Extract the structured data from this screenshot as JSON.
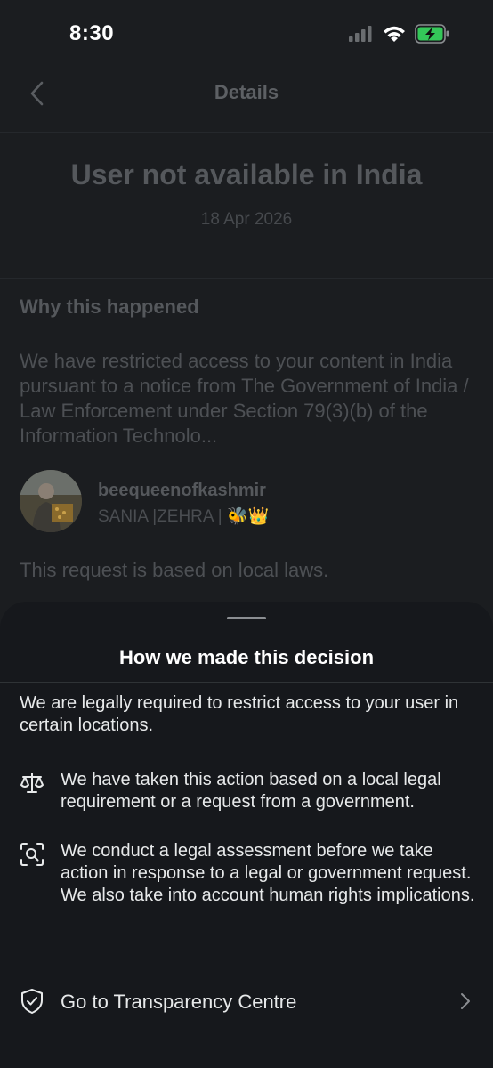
{
  "status": {
    "time": "8:30"
  },
  "nav": {
    "title": "Details"
  },
  "notice": {
    "heading": "User not available in India",
    "date": "18 Apr 2026"
  },
  "why": {
    "title": "Why this happened",
    "text": "We have restricted access to your content in India pursuant to a notice from The Government of India / Law Enforcement under Section 79(3)(b) of the Information Technolo..."
  },
  "user": {
    "handle": "beequeenofkashmir",
    "display_name": "SANIA |ZEHRA | 🐝👑"
  },
  "local_laws": "This request is based on local laws.",
  "sheet": {
    "title": "How we made this decision",
    "intro": "We are legally required to restrict access to your user in certain locations.",
    "items": [
      {
        "icon": "scales-icon",
        "text": "We have taken this action based on a local legal requirement or a request from a government."
      },
      {
        "icon": "search-assessment-icon",
        "text": "We conduct a legal assessment before we take action in response to a legal or government request. We also take into account human rights implications."
      }
    ],
    "link": {
      "icon": "shield-check-icon",
      "label": "Go to Transparency Centre"
    }
  },
  "colors": {
    "battery_charge": "#34c759",
    "sheet_bg": "#16181c",
    "dim_bg": "#1b1d20"
  }
}
